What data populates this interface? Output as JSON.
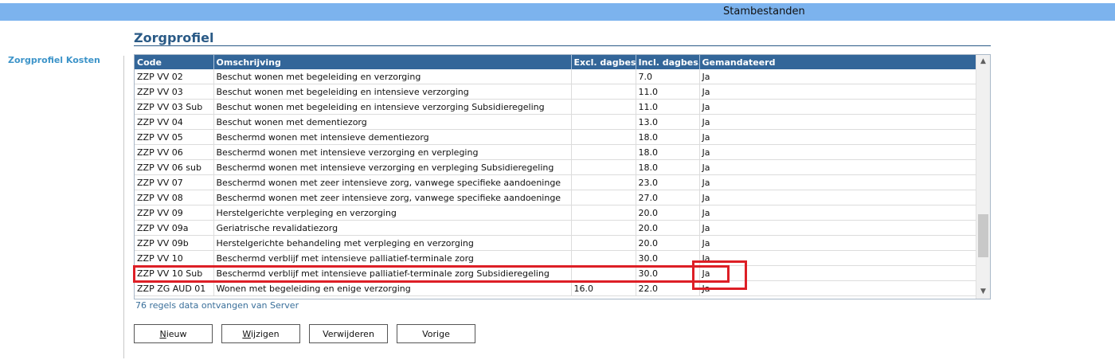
{
  "header": {
    "title": "Stambestanden"
  },
  "sidebar": {
    "link": "Zorgprofiel Kosten"
  },
  "page": {
    "title": "Zorgprofiel"
  },
  "table": {
    "columns": [
      "Code",
      "Omschrijving",
      "Excl. dagbes.",
      "Incl. dagbes.",
      "Gemandateerd"
    ],
    "rows": [
      [
        "ZZP VV 02",
        "Beschut wonen met begeleiding en verzorging",
        "",
        "7.0",
        "Ja"
      ],
      [
        "ZZP VV 03",
        "Beschut wonen met begeleiding en intensieve verzorging",
        "",
        "11.0",
        "Ja"
      ],
      [
        "ZZP VV 03 Sub",
        "Beschut wonen met begeleiding en intensieve verzorging Subsidieregeling",
        "",
        "11.0",
        "Ja"
      ],
      [
        "ZZP VV 04",
        "Beschut wonen met dementiezorg",
        "",
        "13.0",
        "Ja"
      ],
      [
        "ZZP VV 05",
        "Beschermd wonen met intensieve dementiezorg",
        "",
        "18.0",
        "Ja"
      ],
      [
        "ZZP VV 06",
        "Beschermd wonen met intensieve verzorging en verpleging",
        "",
        "18.0",
        "Ja"
      ],
      [
        "ZZP VV 06 sub",
        "Beschermd wonen met intensieve verzorging en verpleging Subsidieregeling",
        "",
        "18.0",
        "Ja"
      ],
      [
        "ZZP VV 07",
        "Beschermd wonen met zeer intensieve zorg, vanwege specifieke aandoeninge",
        "",
        "23.0",
        "Ja"
      ],
      [
        "ZZP VV 08",
        "Beschermd wonen met zeer intensieve zorg, vanwege specifieke aandoeninge",
        "",
        "27.0",
        "Ja"
      ],
      [
        "ZZP VV 09",
        "Herstelgerichte verpleging en verzorging",
        "",
        "20.0",
        "Ja"
      ],
      [
        "ZZP VV 09a",
        "Geriatrische revalidatiezorg",
        "",
        "20.0",
        "Ja"
      ],
      [
        "ZZP VV 09b",
        "Herstelgerichte behandeling met verpleging en verzorging",
        "",
        "20.0",
        "Ja"
      ],
      [
        "ZZP VV 10",
        "Beschermd verblijf met intensieve palliatief-terminale zorg",
        "",
        "30.0",
        "Ja"
      ],
      [
        "ZZP VV 10 Sub",
        "Beschermd verblijf met intensieve palliatief-terminale zorg Subsidieregeling",
        "",
        "30.0",
        "Ja"
      ],
      [
        "ZZP ZG AUD 01",
        "Wonen met begeleiding en enige verzorging",
        "16.0",
        "22.0",
        "Ja"
      ]
    ]
  },
  "status": "76 regels data ontvangen van Server",
  "buttons": {
    "new_first": "N",
    "new_rest": "ieuw",
    "edit_first": "W",
    "edit_rest": "ijzigen",
    "delete": "Verwijderen",
    "prev": "Vorige"
  },
  "icons": {
    "scroll_up": "chevron-up-icon",
    "scroll_down": "chevron-down-icon"
  },
  "colors": {
    "header": "#7cb3ee",
    "grid_header": "#336699",
    "accent": "#3d94c9",
    "highlight": "#dd1f26"
  }
}
